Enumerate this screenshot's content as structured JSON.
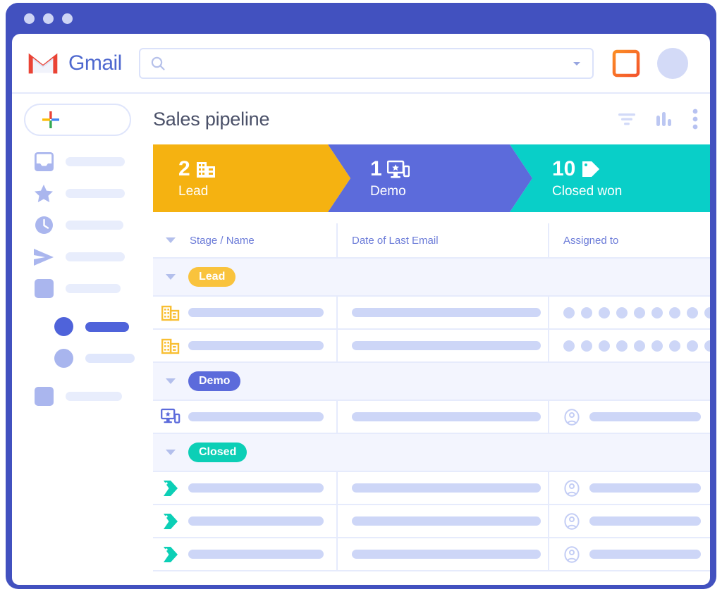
{
  "window": {
    "traffic_lights": [
      "close",
      "minimize",
      "maximize"
    ],
    "frame_color": "#4251bf"
  },
  "header": {
    "brand": "Gmail",
    "logo_icon": "gmail-envelope-icon",
    "search": {
      "value": "",
      "placeholder": "",
      "icon": "search-icon",
      "dropdown_icon": "chevron-down-icon"
    },
    "apps_icon": "layout-grid-icon",
    "avatar": "user-avatar"
  },
  "sidebar": {
    "compose": {
      "label": "",
      "icon": "plus-icon"
    },
    "items": [
      {
        "name": "inbox",
        "icon": "inbox-icon",
        "label": "",
        "active": false
      },
      {
        "name": "starred",
        "icon": "star-icon",
        "label": "",
        "active": false
      },
      {
        "name": "snoozed",
        "icon": "clock-icon",
        "label": "",
        "active": false
      },
      {
        "name": "sent",
        "icon": "send-icon",
        "label": "",
        "active": false
      },
      {
        "name": "drafts",
        "icon": "square-icon",
        "label": "",
        "active": false
      },
      {
        "name": "label-active",
        "icon": "circle-solid-icon",
        "label": "",
        "active": true
      },
      {
        "name": "label-secondary",
        "icon": "circle-light-icon",
        "label": "",
        "active": false
      },
      {
        "name": "more-labels",
        "icon": "square-icon",
        "label": "",
        "active": false
      }
    ]
  },
  "content": {
    "title": "Sales pipeline",
    "actions": [
      {
        "name": "filter",
        "icon": "filter-icon"
      },
      {
        "name": "reports",
        "icon": "bar-chart-icon"
      },
      {
        "name": "more",
        "icon": "more-vertical-icon"
      }
    ]
  },
  "funnel": {
    "segments": [
      {
        "id": "lead",
        "count": "2",
        "label": "Lead",
        "icon": "building-icon",
        "color": "#f5b211"
      },
      {
        "id": "demo",
        "count": "1",
        "label": "Demo",
        "icon": "monitor-star-icon",
        "color": "#5c6bdb"
      },
      {
        "id": "closed",
        "count": "10",
        "label": "Closed won",
        "icon": "tag-icon",
        "color": "#09cfc8"
      }
    ]
  },
  "table": {
    "columns": [
      {
        "key": "stage_name",
        "label": "Stage / Name"
      },
      {
        "key": "last_email",
        "label": "Date of Last Email"
      },
      {
        "key": "assigned_to",
        "label": "Assigned to"
      }
    ],
    "groups": [
      {
        "id": "lead",
        "pill_label": "Lead",
        "pill_color": "#f9c33d",
        "row_icon": "building-icon",
        "assigned_style": "dots",
        "assigned_dot_count": 9,
        "rows": [
          {
            "name": "",
            "date": "",
            "assigned": ""
          },
          {
            "name": "",
            "date": "",
            "assigned": ""
          }
        ]
      },
      {
        "id": "demo",
        "pill_label": "Demo",
        "pill_color": "#5c6bdb",
        "row_icon": "monitor-star-icon",
        "assigned_style": "avatar",
        "rows": [
          {
            "name": "",
            "date": "",
            "assigned": ""
          }
        ]
      },
      {
        "id": "closed",
        "pill_label": "Closed",
        "pill_color": "#0ccfb6",
        "row_icon": "tag-icon",
        "assigned_style": "avatar",
        "rows": [
          {
            "name": "",
            "date": "",
            "assigned": ""
          },
          {
            "name": "",
            "date": "",
            "assigned": ""
          },
          {
            "name": "",
            "date": "",
            "assigned": ""
          }
        ]
      }
    ]
  },
  "colors": {
    "frame": "#4251bf",
    "amber": "#f5b211",
    "indigo": "#5c6bdb",
    "teal": "#09cfc8",
    "placeholder": "#cdd6f7",
    "title_text": "#4a5068",
    "header_text": "#6b7bd8"
  }
}
